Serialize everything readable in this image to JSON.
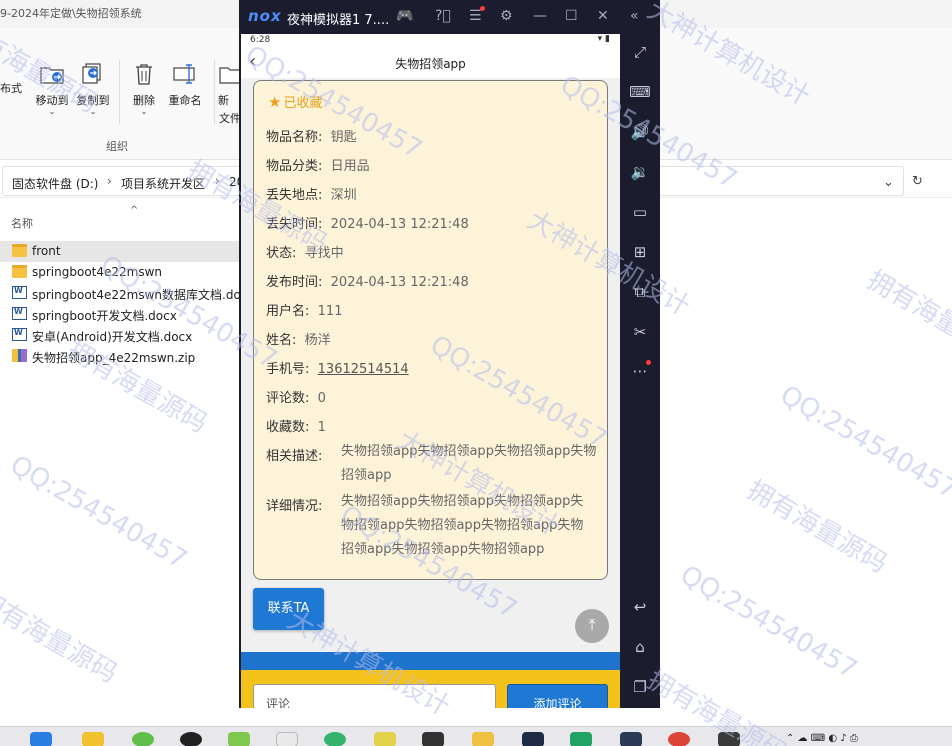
{
  "explorer": {
    "title": "9-2024年定做\\失物招领系统",
    "ribbon": {
      "partial_left": "布式",
      "move_to": "移动到",
      "copy_to": "复制到",
      "delete": "删除",
      "rename": "重命名",
      "new_partial": "新",
      "new_partial_2": "文件",
      "group_label": "组织"
    },
    "address": {
      "crumbs": [
        "固态软件盘 (D:)",
        "项目系统开发区",
        "20"
      ],
      "sep": "›"
    },
    "column_header": "名称",
    "files": [
      {
        "name": "front",
        "type": "folder"
      },
      {
        "name": "springboot4e22mswn",
        "type": "folder"
      },
      {
        "name": "springboot4e22mswn数据库文档.doc",
        "type": "word"
      },
      {
        "name": "springboot开发文档.docx",
        "type": "word"
      },
      {
        "name": "安卓(Android)开发文档.docx",
        "type": "word"
      },
      {
        "name": "失物招领app_4e22mswn.zip",
        "type": "zip"
      }
    ]
  },
  "emulator": {
    "logo": "nox",
    "title": "夜神模拟器1 7....",
    "status_time": "6:28",
    "nav_title": "失物招领app",
    "favorite_label": "已收藏",
    "fields": [
      {
        "key": "物品名称:",
        "value": "钥匙"
      },
      {
        "key": "物品分类:",
        "value": "日用品"
      },
      {
        "key": "丢失地点:",
        "value": "深圳"
      },
      {
        "key": "丢失时间:",
        "value": "2024-04-13 12:21:48"
      },
      {
        "key": "状态:",
        "value": "寻找中"
      },
      {
        "key": "发布时间:",
        "value": "2024-04-13 12:21:48"
      },
      {
        "key": "用户名:",
        "value": "111"
      },
      {
        "key": "姓名:",
        "value": "杨洋"
      },
      {
        "key": "手机号:",
        "value": "13612514514"
      },
      {
        "key": "评论数:",
        "value": "0"
      },
      {
        "key": "收藏数:",
        "value": "1"
      }
    ],
    "description": {
      "key": "相关描述:",
      "value": "失物招领app失物招领app失物招领app失物招领app"
    },
    "details": {
      "key": "详细情况:",
      "value": "失物招领app失物招领app失物招领app失物招领app失物招领app失物招领app失物招领app失物招领app失物招领app"
    },
    "contact_button": "联系TA",
    "comment_placeholder": "评论",
    "add_comment_button": "添加评论"
  },
  "watermarks": [
    "拥有海量源码",
    "QQ:254540457",
    "大神计算机设计"
  ],
  "colors": {
    "accent_blue": "#1e78d4",
    "card_bg": "#fdf3d9",
    "favorite": "#e6a21c",
    "emulator_frame": "#1b1c2e",
    "yellow_bar": "#f5c21b"
  }
}
